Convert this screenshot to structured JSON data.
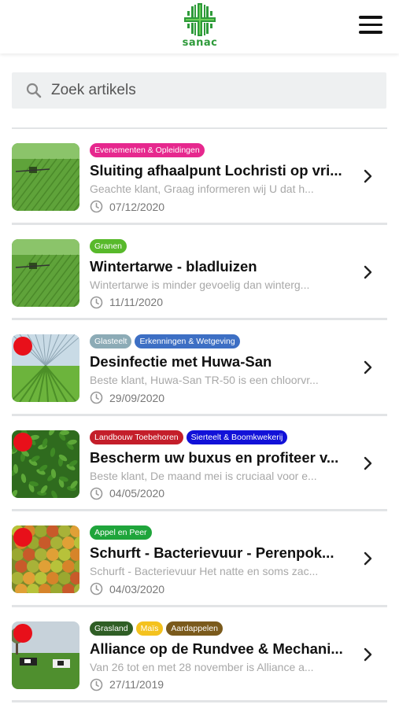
{
  "header": {
    "logo_text": "sanac",
    "menu_icon": "hamburger-menu-icon"
  },
  "search": {
    "placeholder": "Zoek artikels",
    "value": ""
  },
  "articles": [
    {
      "tags": [
        {
          "label": "Evenementen & Opleidingen",
          "color": "#e6288e"
        }
      ],
      "title": "Sluiting afhaalpunt Lochristi op vri...",
      "excerpt": "Geachte klant, Graag informeren wij U dat h...",
      "date": "07/12/2020",
      "unread": false,
      "image": "green-field-sprayer"
    },
    {
      "tags": [
        {
          "label": "Granen",
          "color": "#58b92b"
        }
      ],
      "title": "Wintertarwe - bladluizen",
      "excerpt": "Wintertarwe is minder gevoelig dan winterg...",
      "date": "11/11/2020",
      "unread": false,
      "image": "green-field-sprayer"
    },
    {
      "tags": [
        {
          "label": "Glasteelt",
          "color": "#8cabb6"
        },
        {
          "label": "Erkenningen & Wetgeving",
          "color": "#3d6fc4"
        }
      ],
      "title": "Desinfectie met Huwa-San",
      "excerpt": "Beste klant, Huwa-San TR-50 is een chloorvr...",
      "date": "29/09/2020",
      "unread": true,
      "image": "greenhouse"
    },
    {
      "tags": [
        {
          "label": "Landbouw Toebehoren",
          "color": "#c41e2a"
        },
        {
          "label": "Sierteelt & Boomkwekerij",
          "color": "#1111d8"
        }
      ],
      "title": "Bescherm uw buxus en profiteer v...",
      "excerpt": "Beste klant, De maand mei is cruciaal voor e...",
      "date": "04/05/2020",
      "unread": true,
      "image": "buxus"
    },
    {
      "tags": [
        {
          "label": "Appel en Peer",
          "color": "#1fa53b"
        }
      ],
      "title": "Schurft - Bacterievuur - Perenpok...",
      "excerpt": "Schurft - Bacterievuur Het natte en soms zac...",
      "date": "04/03/2020",
      "unread": true,
      "image": "apples"
    },
    {
      "tags": [
        {
          "label": "Grasland",
          "color": "#2f5e25"
        },
        {
          "label": "Maïs",
          "color": "#f4c21e"
        },
        {
          "label": "Aardappelen",
          "color": "#7a5a1c"
        }
      ],
      "title": "Alliance op de Rundvee & Mechani...",
      "excerpt": "Van 26 tot en met 28 november is Alliance a...",
      "date": "27/11/2019",
      "unread": true,
      "image": "cows"
    }
  ]
}
